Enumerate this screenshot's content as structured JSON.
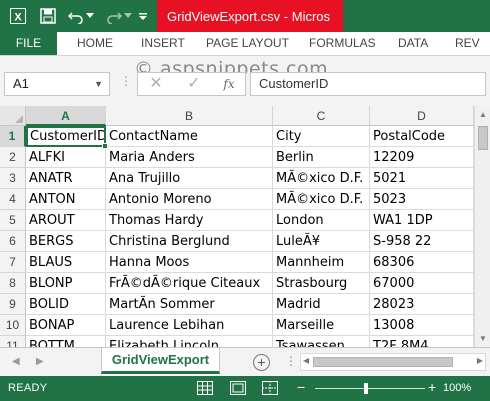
{
  "window": {
    "title": "GridViewExport.csv - Micros"
  },
  "ribbon": {
    "tabs": [
      "FILE",
      "HOME",
      "INSERT",
      "PAGE LAYOUT",
      "FORMULAS",
      "DATA",
      "REV"
    ]
  },
  "watermark": "© aspsnippets.com",
  "formula_bar": {
    "name_box": "A1",
    "fx_label": "fx",
    "value": "CustomerID"
  },
  "sheet": {
    "columns": [
      "A",
      "B",
      "C",
      "D"
    ],
    "row_numbers": [
      "1",
      "2",
      "3",
      "4",
      "5",
      "6",
      "7",
      "8",
      "9",
      "10",
      "11"
    ],
    "rows": [
      [
        "CustomerID",
        "ContactName",
        "City",
        "PostalCode"
      ],
      [
        "ALFKI",
        "Maria Anders",
        "Berlin",
        "12209"
      ],
      [
        "ANATR",
        "Ana Trujillo",
        "MÃ©xico D.F.",
        "5021"
      ],
      [
        "ANTON",
        "Antonio Moreno",
        "MÃ©xico D.F.",
        "5023"
      ],
      [
        "AROUT",
        "Thomas Hardy",
        "London",
        "WA1 1DP"
      ],
      [
        "BERGS",
        "Christina Berglund",
        "LuleÃ¥",
        "S-958 22"
      ],
      [
        "BLAUS",
        "Hanna Moos",
        "Mannheim",
        "68306"
      ],
      [
        "BLONP",
        "FrÃ©dÃ©rique Citeaux",
        "Strasbourg",
        "67000"
      ],
      [
        "BOLID",
        "MartÃ­n Sommer",
        "Madrid",
        "28023"
      ],
      [
        "BONAP",
        "Laurence Lebihan",
        "Marseille",
        "13008"
      ],
      [
        "BOTTM",
        "Elizabeth Lincoln",
        "Tsawassen",
        "T2F 8M4"
      ]
    ],
    "selected_cell": "A1"
  },
  "sheet_tabs": {
    "active": "GridViewExport"
  },
  "status_bar": {
    "status": "READY",
    "zoom": "100%",
    "zoom_minus": "−",
    "zoom_plus": "+"
  },
  "colors": {
    "excel_green": "#217346",
    "title_highlight": "#e81123"
  }
}
